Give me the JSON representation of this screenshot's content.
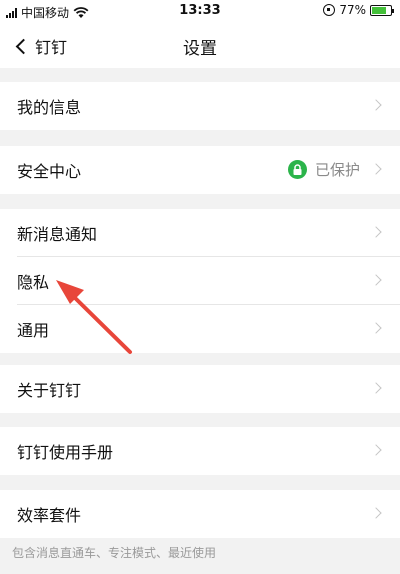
{
  "status_bar": {
    "carrier": "中国移动",
    "time": "13:33",
    "battery": "77%",
    "battery_level": 0.77,
    "icons": [
      "signal-icon",
      "wifi-icon",
      "rotation-lock-icon",
      "battery-icon"
    ]
  },
  "nav": {
    "back_label": "钉钉",
    "title": "设置"
  },
  "rows": {
    "my_info": "我的信息",
    "security": "安全中心",
    "security_status": "已保护",
    "notifications": "新消息通知",
    "privacy": "隐私",
    "general": "通用",
    "about": "关于钉钉",
    "manual": "钉钉使用手册",
    "efficiency": "效率套件"
  },
  "footnote": "包含消息直通车、专注模式、最近使用",
  "colors": {
    "accent_green": "#2bb44a",
    "arrow_red": "#e8463a",
    "background": "#f2f2f2"
  }
}
